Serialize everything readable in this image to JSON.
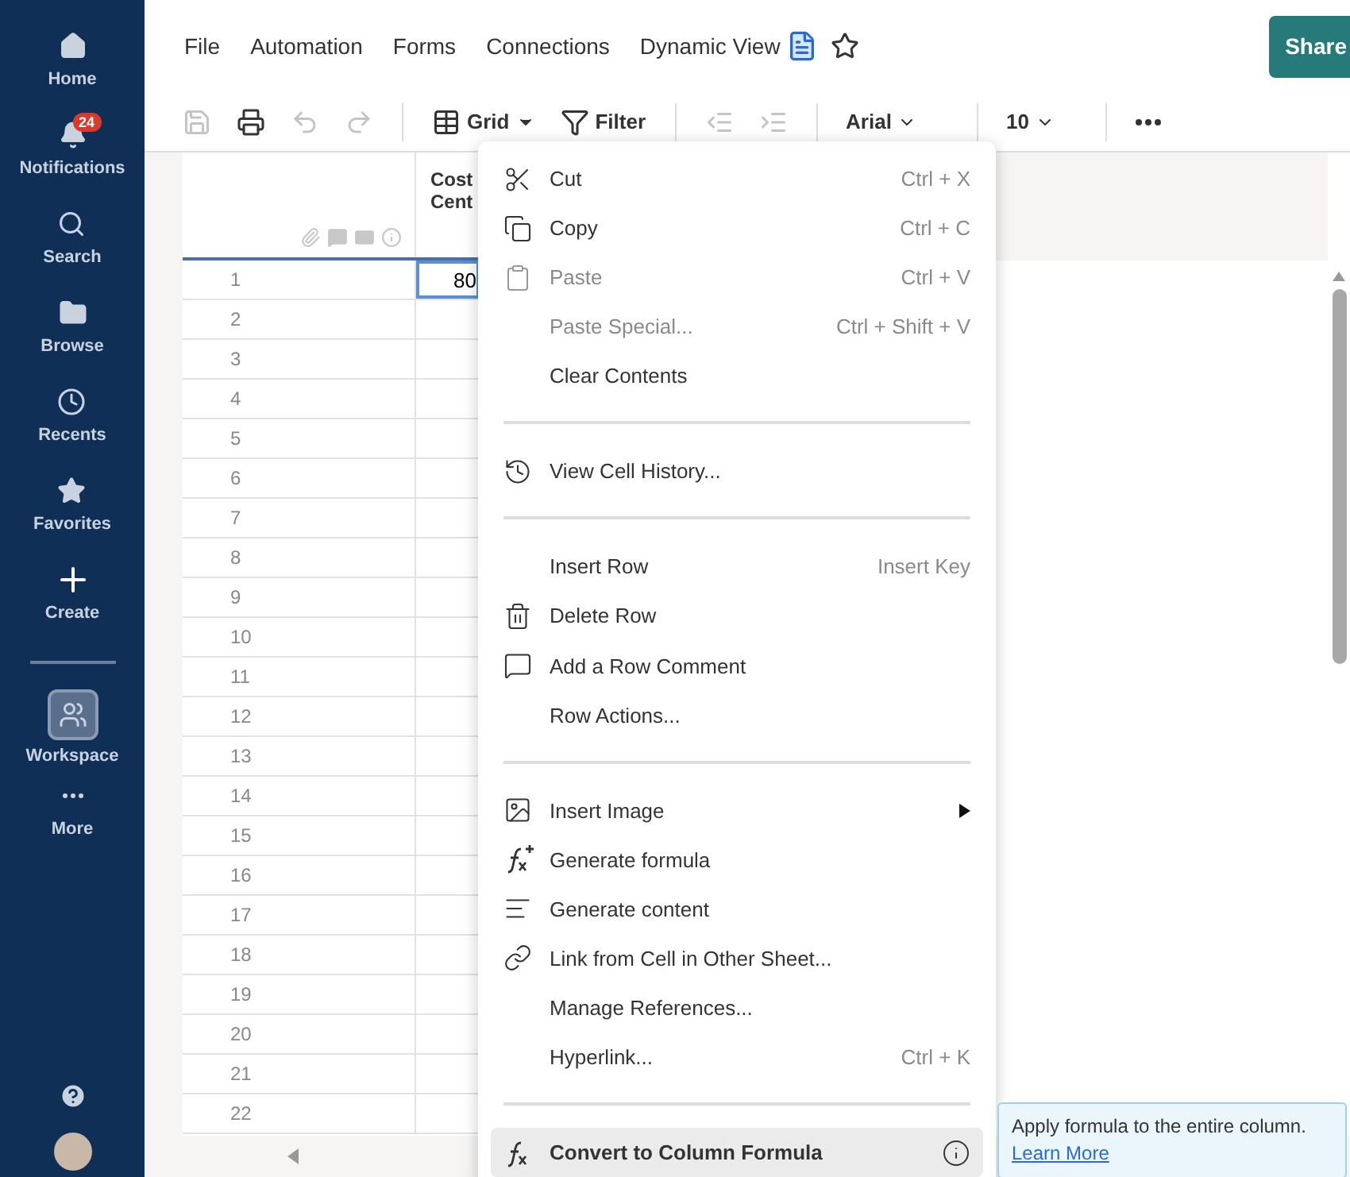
{
  "sidebar": {
    "items": [
      {
        "label": "Home",
        "selected": false
      },
      {
        "label": "Notifications",
        "selected": false,
        "badge": "24"
      },
      {
        "label": "Search",
        "selected": false
      },
      {
        "label": "Browse",
        "selected": false
      },
      {
        "label": "Recents",
        "selected": false
      },
      {
        "label": "Favorites",
        "selected": false
      },
      {
        "label": "Create",
        "selected": false
      },
      {
        "label": "Workspace",
        "selected": true
      },
      {
        "label": "More",
        "selected": false
      }
    ]
  },
  "menu_bar": {
    "items": [
      "File",
      "Automation",
      "Forms",
      "Connections",
      "Dynamic View"
    ],
    "share": "Share"
  },
  "toolbar": {
    "view": "Grid",
    "filter": "Filter",
    "font": "Arial",
    "size": "10"
  },
  "grid": {
    "column_header": "Cost Cent",
    "rows": [
      {
        "label": "1",
        "value": "80",
        "selected": true
      },
      {
        "label": "2",
        "selected": false
      },
      {
        "label": "3",
        "selected": false
      },
      {
        "label": "4",
        "selected": false
      },
      {
        "label": "5",
        "selected": false
      },
      {
        "label": "6",
        "selected": false
      },
      {
        "label": "7",
        "selected": false
      },
      {
        "label": "8",
        "selected": false
      },
      {
        "label": "9",
        "selected": false
      },
      {
        "label": "10",
        "selected": false
      },
      {
        "label": "11",
        "selected": false
      },
      {
        "label": "12",
        "selected": false
      },
      {
        "label": "13",
        "selected": false
      },
      {
        "label": "14",
        "selected": false
      },
      {
        "label": "15",
        "selected": false
      },
      {
        "label": "16",
        "selected": false
      },
      {
        "label": "17",
        "selected": false
      },
      {
        "label": "18",
        "selected": false
      },
      {
        "label": "19",
        "selected": false
      },
      {
        "label": "20",
        "selected": false
      },
      {
        "label": "21",
        "selected": false
      },
      {
        "label": "22",
        "selected": false
      }
    ]
  },
  "context_menu": {
    "items": [
      {
        "kind": "item",
        "label": "Cut",
        "shortcut": "Ctrl + X",
        "disabled": false,
        "selected": false
      },
      {
        "kind": "item",
        "label": "Copy",
        "shortcut": "Ctrl + C",
        "disabled": false,
        "selected": false
      },
      {
        "kind": "item",
        "label": "Paste",
        "shortcut": "Ctrl + V",
        "disabled": true,
        "selected": false
      },
      {
        "kind": "item",
        "label": "Paste Special...",
        "shortcut": "Ctrl + Shift + V",
        "disabled": true,
        "selected": false
      },
      {
        "kind": "item",
        "label": "Clear Contents",
        "disabled": false,
        "selected": false
      },
      {
        "kind": "separator"
      },
      {
        "kind": "item",
        "label": "View Cell History...",
        "disabled": false,
        "selected": false
      },
      {
        "kind": "separator"
      },
      {
        "kind": "item",
        "label": "Insert Row",
        "shortcut": "Insert Key",
        "disabled": false,
        "selected": false
      },
      {
        "kind": "item",
        "label": "Delete Row",
        "disabled": false,
        "selected": false
      },
      {
        "kind": "item",
        "label": "Add a Row Comment",
        "disabled": false,
        "selected": false
      },
      {
        "kind": "item",
        "label": "Row Actions...",
        "disabled": false,
        "selected": false
      },
      {
        "kind": "separator"
      },
      {
        "kind": "item",
        "label": "Insert Image",
        "submenu": true,
        "disabled": false,
        "selected": false
      },
      {
        "kind": "item",
        "label": "Generate formula",
        "disabled": false,
        "selected": false
      },
      {
        "kind": "item",
        "label": "Generate content",
        "disabled": false,
        "selected": false
      },
      {
        "kind": "item",
        "label": "Link from Cell in Other Sheet...",
        "disabled": false,
        "selected": false
      },
      {
        "kind": "item",
        "label": "Manage References...",
        "disabled": false,
        "selected": false
      },
      {
        "kind": "item",
        "label": "Hyperlink...",
        "shortcut": "Ctrl + K",
        "disabled": false,
        "selected": false
      },
      {
        "kind": "separator"
      },
      {
        "kind": "item",
        "label": "Convert to Column Formula",
        "info": true,
        "disabled": false,
        "selected": true
      }
    ]
  },
  "tooltip": {
    "text": "Apply formula to the entire column.",
    "link": "Learn More"
  }
}
